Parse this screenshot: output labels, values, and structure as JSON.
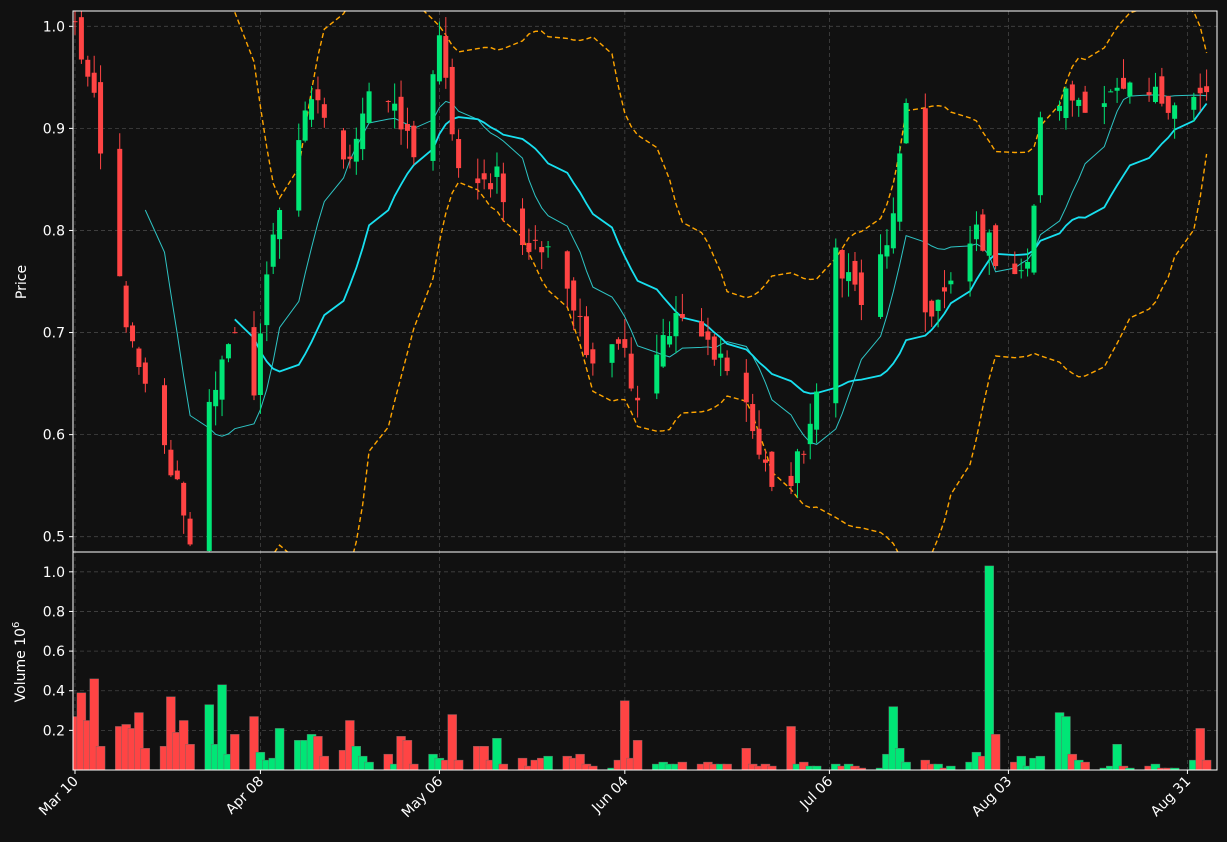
{
  "chart_data": [
    {
      "type": "candlestick",
      "panel": "price",
      "ylabel": "Price",
      "ylim": [
        0.485,
        1.015
      ],
      "yticks": [
        "0.5",
        "0.6",
        "0.7",
        "0.8",
        "0.9",
        "1.0"
      ],
      "grid": true,
      "colors": {
        "up": "#00e676",
        "down": "#ff4444",
        "ma_fast": "#2ec4c4",
        "ma_slow": "#18e0f0",
        "bands": "#ffa500",
        "background": "#111111",
        "grid": "#444444"
      },
      "keypoints": [
        {
          "d": 0,
          "c": 1.0
        },
        {
          "d": 3,
          "c": 0.92
        },
        {
          "d": 5,
          "c": 0.82
        },
        {
          "d": 9,
          "c": 0.68
        },
        {
          "d": 13,
          "c": 0.6
        },
        {
          "d": 17,
          "c": 0.53
        },
        {
          "d": 18,
          "c": 0.49
        },
        {
          "d": 21,
          "c": 0.64
        },
        {
          "d": 25,
          "c": 0.69
        },
        {
          "d": 28,
          "c": 0.65
        },
        {
          "d": 31,
          "c": 0.8
        },
        {
          "d": 34,
          "c": 0.88
        },
        {
          "d": 38,
          "c": 0.93
        },
        {
          "d": 42,
          "c": 0.86
        },
        {
          "d": 47,
          "c": 0.96
        },
        {
          "d": 50,
          "c": 0.91
        },
        {
          "d": 53,
          "c": 0.88
        },
        {
          "d": 57,
          "c": 0.98
        },
        {
          "d": 61,
          "c": 0.82
        },
        {
          "d": 66,
          "c": 0.86
        },
        {
          "d": 70,
          "c": 0.78
        },
        {
          "d": 75,
          "c": 0.79
        },
        {
          "d": 80,
          "c": 0.68
        },
        {
          "d": 85,
          "c": 0.7
        },
        {
          "d": 88,
          "c": 0.64
        },
        {
          "d": 92,
          "c": 0.7
        },
        {
          "d": 96,
          "c": 0.72
        },
        {
          "d": 100,
          "c": 0.67
        },
        {
          "d": 103,
          "c": 0.68
        },
        {
          "d": 107,
          "c": 0.58
        },
        {
          "d": 111,
          "c": 0.53
        },
        {
          "d": 113,
          "c": 0.57
        },
        {
          "d": 117,
          "c": 0.65
        },
        {
          "d": 119,
          "c": 0.78
        },
        {
          "d": 123,
          "c": 0.73
        },
        {
          "d": 127,
          "c": 0.78
        },
        {
          "d": 130,
          "c": 0.91
        },
        {
          "d": 133,
          "c": 0.72
        },
        {
          "d": 137,
          "c": 0.74
        },
        {
          "d": 141,
          "c": 0.8
        },
        {
          "d": 145,
          "c": 0.77
        },
        {
          "d": 149,
          "c": 0.76
        },
        {
          "d": 151,
          "c": 0.9
        },
        {
          "d": 153,
          "c": 0.93
        }
      ]
    },
    {
      "type": "bar",
      "panel": "volume",
      "ylabel": "Volume  10",
      "ylabel_exponent": "6",
      "ylim": [
        0,
        1.1
      ],
      "yticks": [
        "0.2",
        "0.4",
        "0.6",
        "0.8",
        "1.0"
      ],
      "grid": true,
      "xticks": [
        {
          "label": "Mar 10",
          "d": 0
        },
        {
          "label": "Apr 08",
          "d": 29
        },
        {
          "label": "May 06",
          "d": 57
        },
        {
          "label": "Jun 04",
          "d": 86
        },
        {
          "label": "Jul 06",
          "d": 118
        },
        {
          "label": "Aug 03",
          "d": 146
        },
        {
          "label": "Aug 31",
          "d": 174
        }
      ],
      "values": [
        0.27,
        0.39,
        0.25,
        0.46,
        0.12,
        0.22,
        0.23,
        0.21,
        0.29,
        0.11,
        0.12,
        0.37,
        0.19,
        0.25,
        0.13,
        0.33,
        0.13,
        0.43,
        0.08,
        0.18,
        0.27,
        0.09,
        0.05,
        0.06,
        0.21,
        0.15,
        0.15,
        0.18,
        0.17,
        0.07,
        0.1,
        0.25,
        0.12,
        0.07,
        0.04,
        0.08,
        0.03,
        0.17,
        0.15,
        0.03,
        0.08,
        0.06,
        0.05,
        0.28,
        0.05,
        0.12,
        0.12,
        0.05,
        0.16,
        0.03,
        0.06,
        0.02,
        0.05,
        0.06,
        0.07,
        0.07,
        0.06,
        0.08,
        0.03,
        0.02,
        0.01,
        0.05,
        0.35,
        0.06,
        0.15,
        0.03,
        0.04,
        0.03,
        0.03,
        0.04,
        0.03,
        0.04,
        0.03,
        0.03,
        0.03,
        0.11,
        0.03,
        0.02,
        0.03,
        0.02,
        0.22,
        0.03,
        0.04,
        0.02,
        0.02,
        0.03,
        0.02,
        0.03,
        0.02,
        0.01,
        0.01,
        0.08,
        0.32,
        0.11,
        0.04,
        0.05,
        0.03,
        0.03,
        0.01,
        0.02,
        0.04,
        0.09,
        0.07,
        1.03,
        0.18,
        0.04,
        0.07,
        0.02,
        0.06,
        0.07,
        0.29,
        0.27,
        0.08,
        0.05,
        0.04,
        0.01,
        0.02,
        0.13,
        0.02,
        0.01,
        0.02,
        0.03,
        0.01,
        0.01,
        0.01,
        0.05,
        0.21,
        0.05
      ]
    }
  ]
}
